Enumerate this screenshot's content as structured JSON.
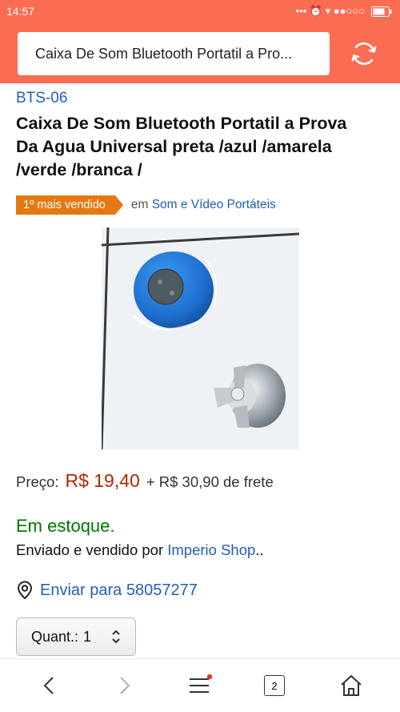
{
  "status_bar": {
    "time": "14:57",
    "indicators": "•••  ⏰  ▾  ●●○○○",
    "battery_icon": "battery-icon"
  },
  "address_bar": {
    "url_text": "Caixa De Som Bluetooth Portatil a Pro...",
    "reload_icon": "reload-icon"
  },
  "product": {
    "model": "BTS-06",
    "title": "Caixa De Som Bluetooth Portatil a Prova Da Agua Universal preta /azul /amarela /verde /branca /",
    "best_seller_badge": "1º mais vendido",
    "category_prefix": "em",
    "category_link": "Som e Vídeo Portáteis",
    "price_label": "Preço:",
    "price_value": "R$ 19,40",
    "shipping_cost": "+ R$ 30,90 de frete",
    "stock_status": "Em estoque.",
    "sold_by_prefix": "Enviado e vendido por",
    "seller": "Imperio Shop",
    "sold_by_suffix": "..",
    "ship_to": "Enviar para 58057277",
    "quantity_label": "Quant.:",
    "quantity_value": "1"
  },
  "browser_nav": {
    "tab_count": "2"
  },
  "colors": {
    "header": "#fa6d52",
    "link": "#1f5fb8",
    "price": "#b12704",
    "stock": "#007600",
    "badge": "#e47911"
  }
}
